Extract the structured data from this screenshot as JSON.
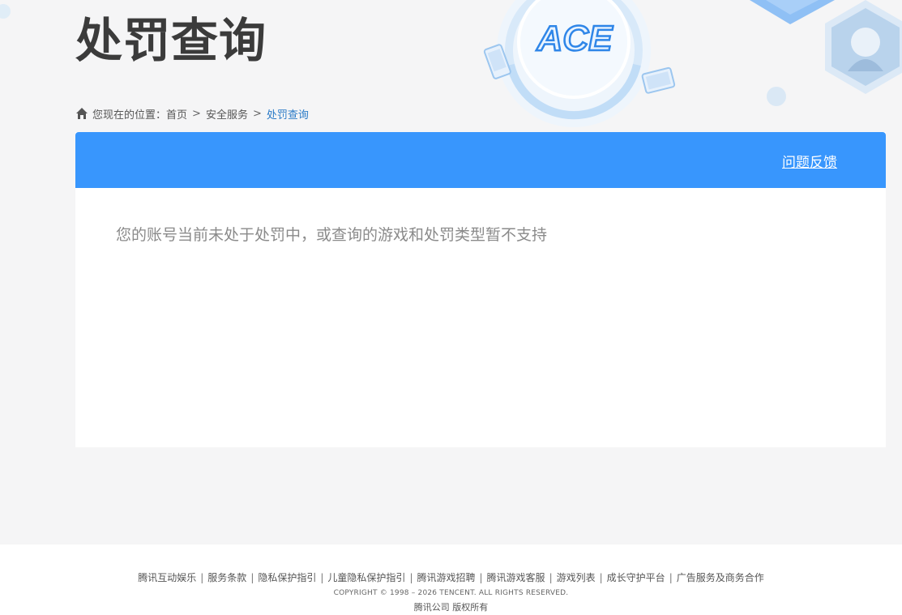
{
  "page": {
    "title": "处罚查询"
  },
  "breadcrumb": {
    "prefix": "您现在的位置：",
    "items": [
      "首页",
      "安全服务",
      "处罚查询"
    ],
    "separator": ">"
  },
  "panel": {
    "feedback_label": "问题反馈",
    "result_message": "您的账号当前未处于处罚中，或查询的游戏和处罚类型暂不支持"
  },
  "footer": {
    "links": [
      "腾讯互动娱乐",
      "服务条款",
      "隐私保护指引",
      "儿童隐私保护指引",
      "腾讯游戏招聘",
      "腾讯游戏客服",
      "游戏列表",
      "成长守护平台",
      "广告服务及商务合作"
    ],
    "copyright": "COPYRIGHT © 1998 – 2026 TENCENT. ALL RIGHTS RESERVED.",
    "company": "腾讯公司 版权所有"
  },
  "logo": {
    "text": "ACE"
  },
  "colors": {
    "header_bar": "#3896fd",
    "breadcrumb_current": "#2b7bc7",
    "result_text": "#8a8a8a"
  }
}
